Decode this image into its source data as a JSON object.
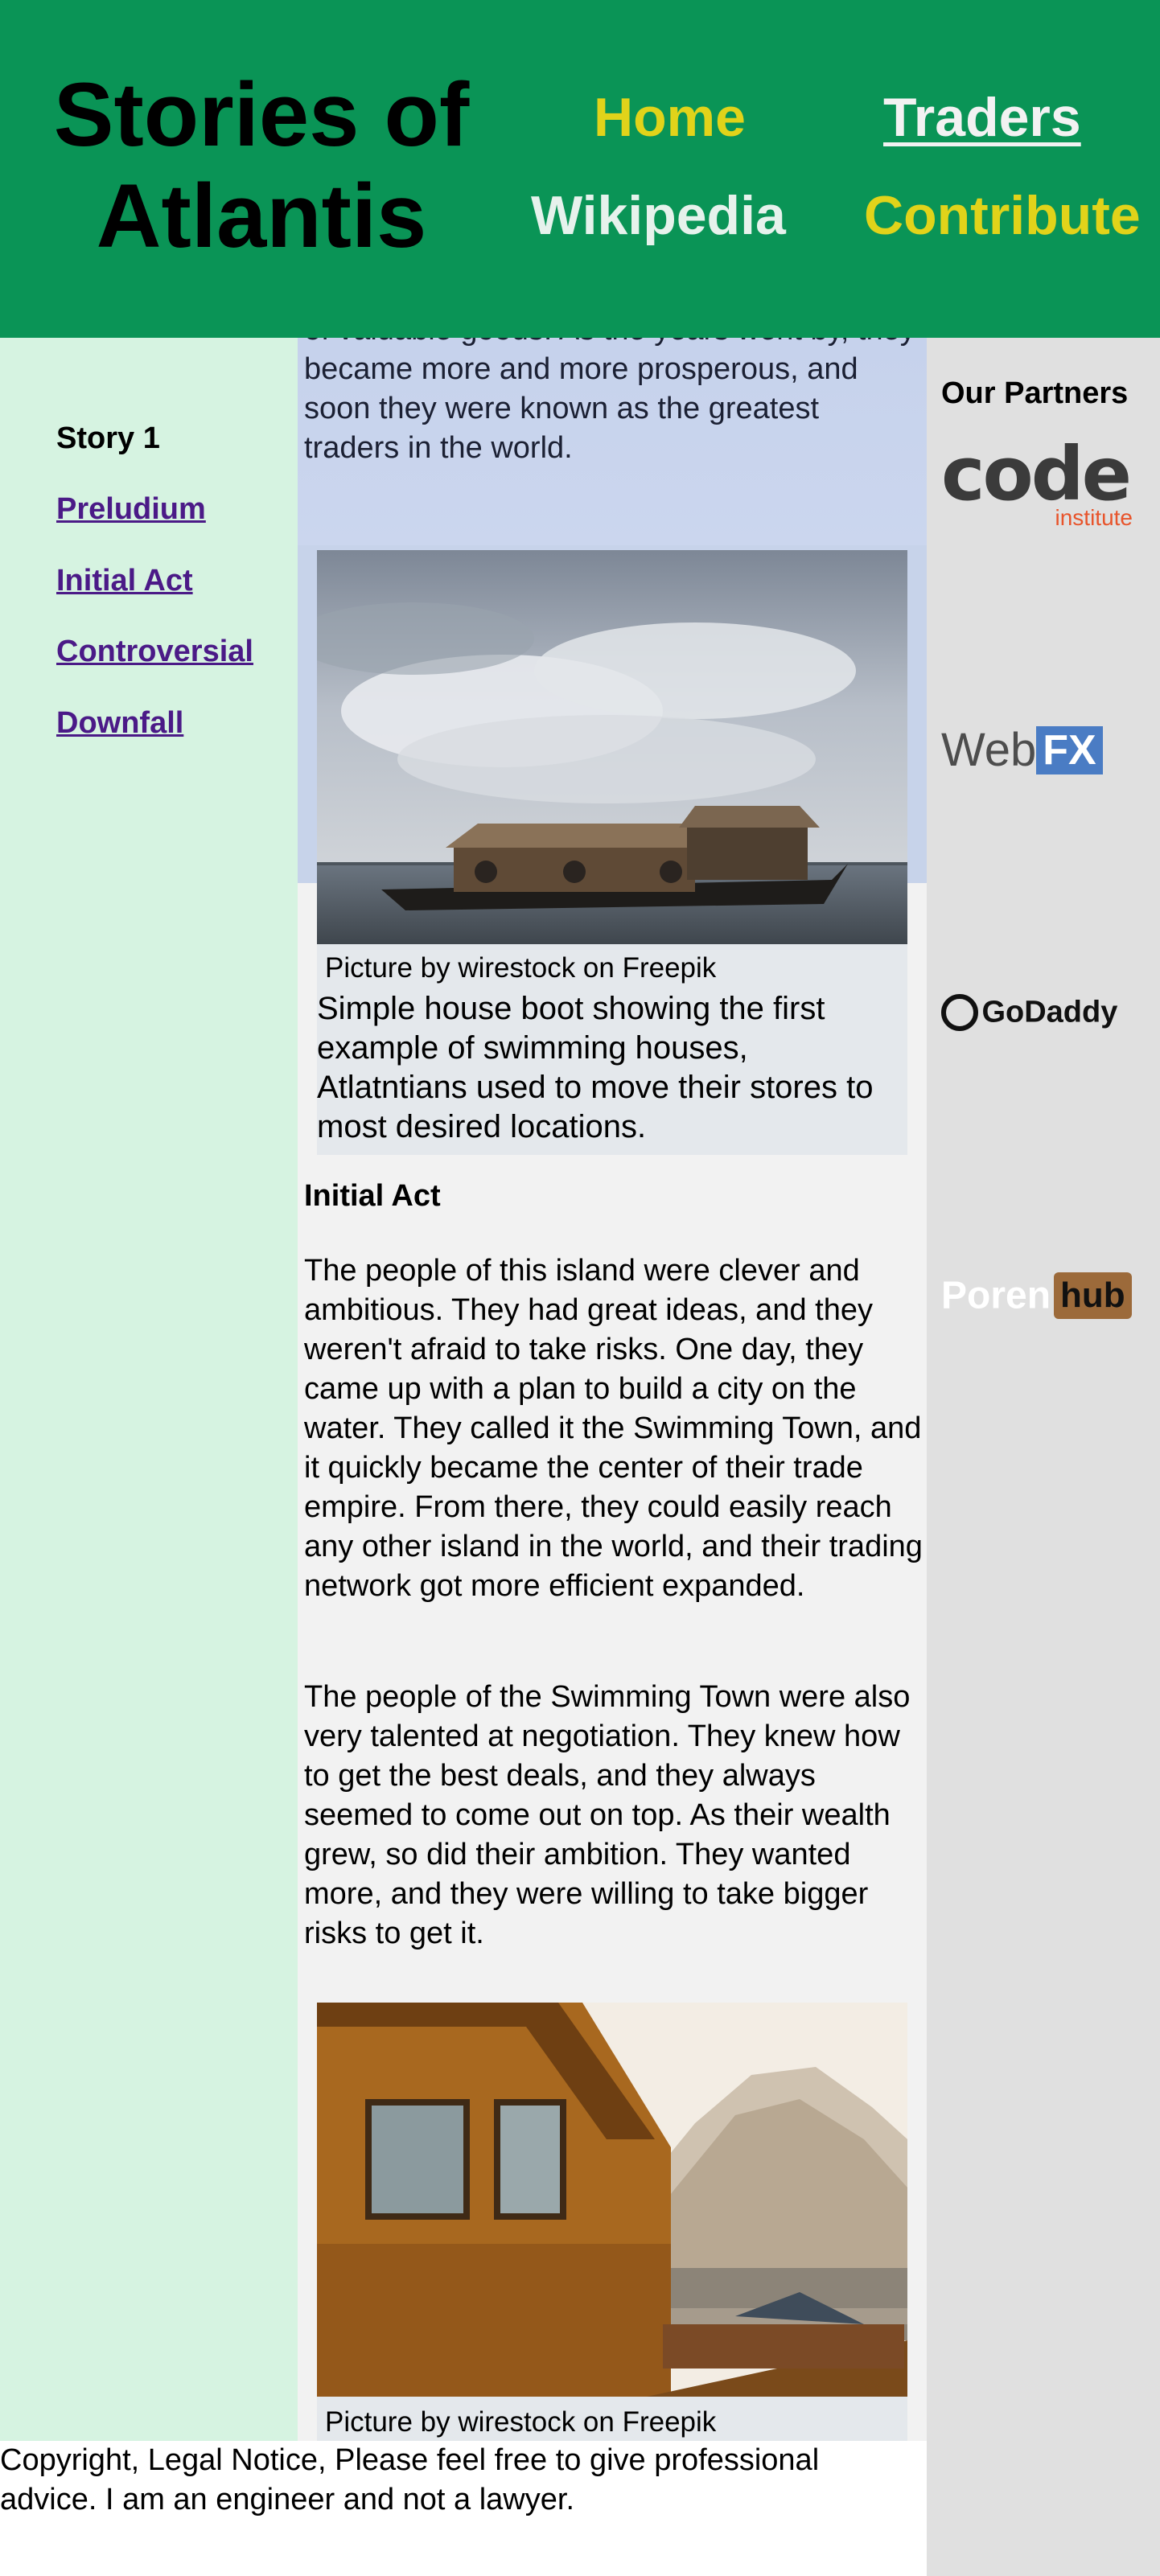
{
  "header": {
    "title": "Stories of Atlantis",
    "nav": {
      "home": "Home",
      "traders": "Traders",
      "wikipedia": "Wikipedia",
      "contribute": "Contribute"
    }
  },
  "left_sidebar": {
    "heading": "Story 1",
    "links": [
      "Preludium",
      "Initial Act",
      "Controversial",
      "Downfall"
    ]
  },
  "main": {
    "top_text": "of valuable goods. As the years went by, they became more and more prosperous, and soon they were known as the greatest traders in the world.",
    "figure1": {
      "credit": "Picture by wirestock on Freepik",
      "caption": "Simple house boot showing the first example of swimming houses, Atlatntians used to move their stores to most desired locations."
    },
    "section_heading": "Initial Act",
    "paragraph1": "The people of this island were clever and ambitious. They had great ideas, and they weren't afraid to take risks. One day, they came up with a plan to build a city on the water. They called it the Swimming Town, and it quickly became the center of their trade empire. From there, they could easily reach any other island in the world, and their trading network got more efficient expanded.",
    "paragraph2": "The people of the Swimming Town were also very talented at negotiation. They knew how to get the best deals, and they always seemed to come out on top. As their wealth grew, so did their ambition. They wanted more, and they were willing to take bigger risks to get it.",
    "figure2": {
      "credit": "Picture by wirestock on Freepik"
    }
  },
  "right_sidebar": {
    "heading": "Our Partners",
    "logos": [
      {
        "name": "code institute",
        "wordmark": "code",
        "sub": "institute",
        "color": "#e8542b"
      },
      {
        "name": "WebFX",
        "wordmark": "Web",
        "badge": "FX",
        "color": "#4a7cc4"
      },
      {
        "name": "GoDaddy",
        "wordmark": "GoDaddy"
      },
      {
        "name": "Pornhub",
        "wordmark": "Poren",
        "badge": "hub",
        "color": "#9c6a3a"
      }
    ]
  },
  "footer": {
    "text": "Copyright, Legal Notice, Please feel free to give professional advice. I am an engineer and not a lawyer."
  }
}
